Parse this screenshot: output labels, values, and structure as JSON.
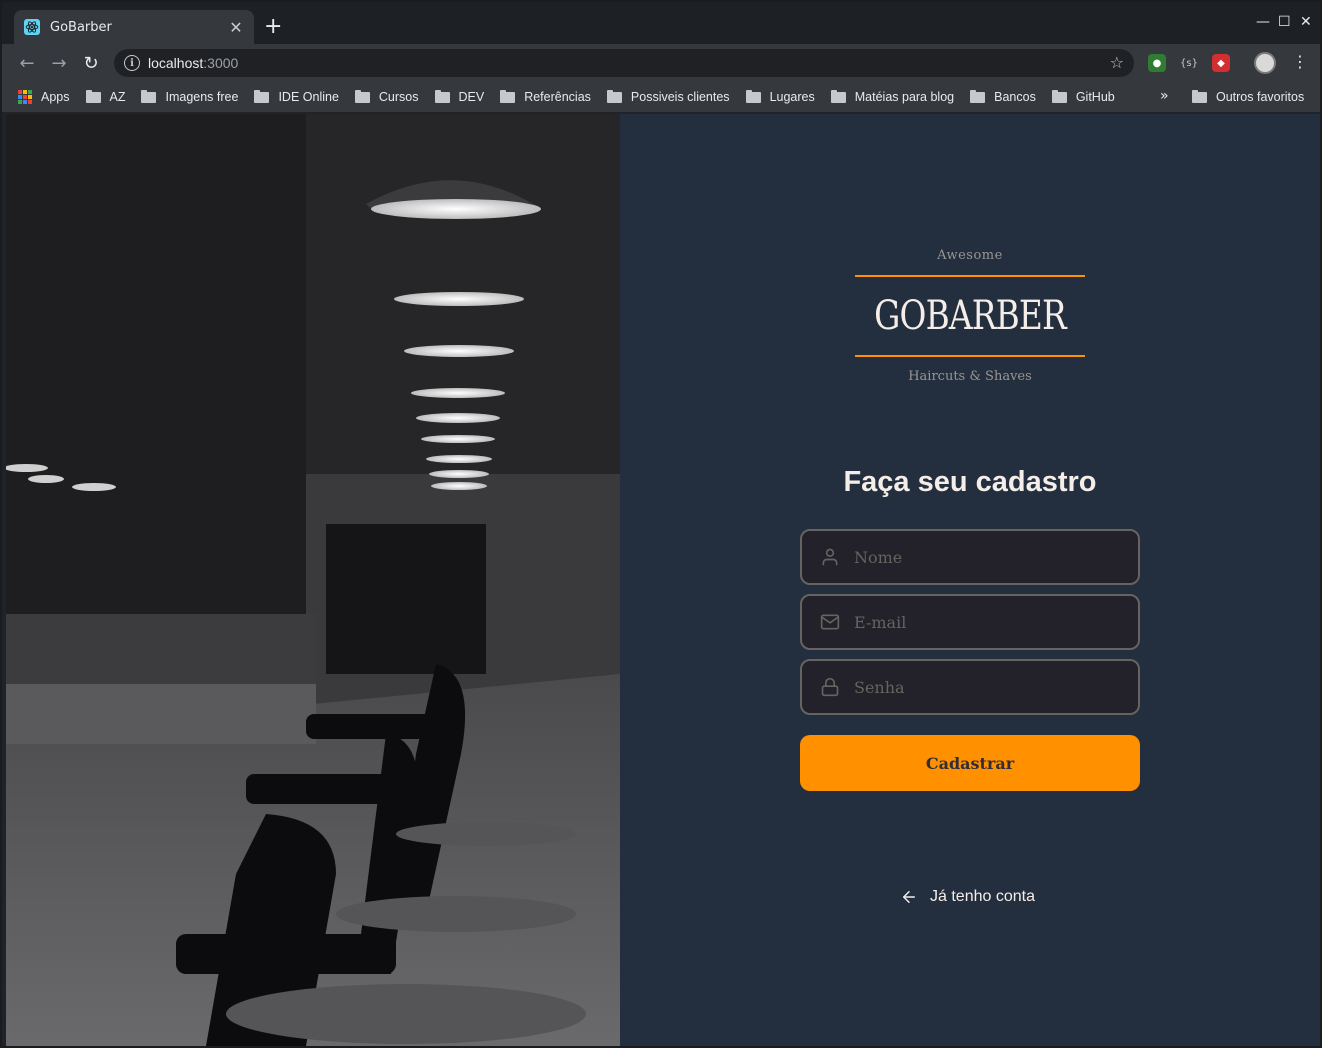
{
  "browser": {
    "tab_title": "GoBarber",
    "url_host": "localhost",
    "url_port": ":3000",
    "bookmarks": [
      "AZ",
      "Imagens free",
      "IDE Online",
      "Cursos",
      "DEV",
      "Referências",
      "Possiveis clientes",
      "Lugares",
      "Matéias para blog",
      "Bancos",
      "GitHub"
    ],
    "apps_label": "Apps",
    "more_label": "»",
    "other_bookmarks": "Outros favoritos"
  },
  "logo": {
    "top": "Awesome",
    "brand": "GOBARBER",
    "bottom": "Haircuts & Shaves"
  },
  "form": {
    "title": "Faça seu cadastro",
    "name_placeholder": "Nome",
    "email_placeholder": "E-mail",
    "password_placeholder": "Senha",
    "submit_label": "Cadastrar",
    "back_label": "Já tenho conta"
  },
  "colors": {
    "accent": "#ff9000",
    "background": "#232f3e",
    "input_background": "#232129",
    "text": "#f4ede8",
    "muted": "#666360"
  },
  "hero": {
    "icon": "barbershop-photo"
  }
}
